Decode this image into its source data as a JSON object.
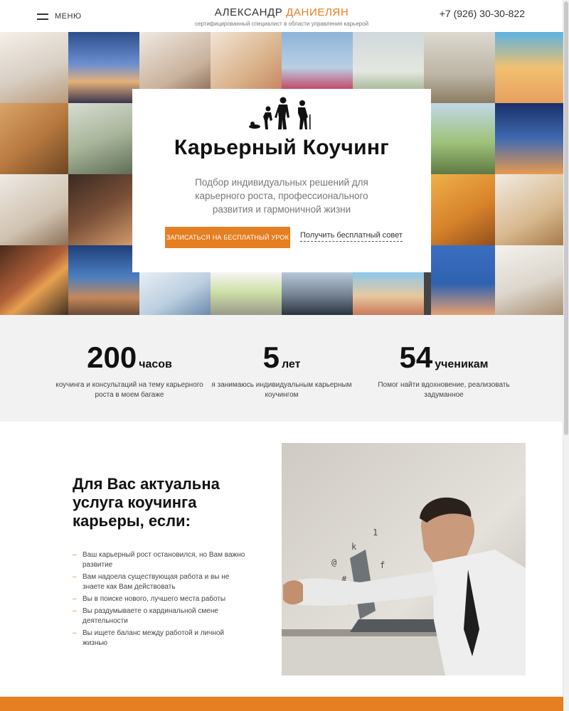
{
  "header": {
    "menu_label": "МЕНЮ",
    "brand_first": "АЛЕКСАНДР",
    "brand_last": "ДАНИЕЛЯН",
    "brand_sub": "сертифицированный специалист в области управления карьерой",
    "phone": "+7 (926) 30-30-822"
  },
  "hero": {
    "title": "Карьерный Коучинг",
    "subtitle": "Подбор индивидуальных решений для карьерного роста, профессионального развития и гармоничной жизни",
    "cta_label": "ЗАПИСАТЬСЯ НА БЕСПЛАТНЫЙ УРОК",
    "advice_link": "Получить бесплатный совет"
  },
  "stats": [
    {
      "number": "200",
      "unit": "часов",
      "desc": "коучинга и консультаций на тему карьерного роста в моем багаже"
    },
    {
      "number": "5",
      "unit": "лет",
      "desc": "я занимаюсь индивидуальным карьерным коучингом"
    },
    {
      "number": "54",
      "unit": "ученикам",
      "desc": "Помог найти вдохновение, реализовать задуманное"
    }
  ],
  "section": {
    "title": "Для Вас актуальна услуга коучинга карьеры, если:",
    "items": [
      "Ваш карьерный рост остановился, но Вам важно развитие",
      "Вам надоела существующая работа и вы не знаете как Вам действовать",
      "Вы в поиске нового, лучшего места работы",
      "Вы раздумываете о кардинальной смене деятельности",
      "Вы ищете баланс между работой и личной жизнью"
    ],
    "bullet": "–"
  },
  "colors": {
    "accent": "#e67e22",
    "stats_bg": "#f2f2f2"
  }
}
